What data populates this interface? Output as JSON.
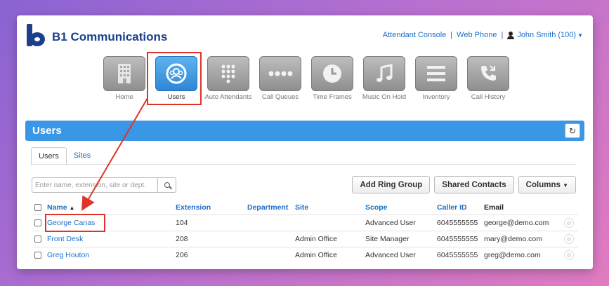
{
  "brand": {
    "name": "B1 Communications"
  },
  "topnav": {
    "attendant_console": "Attendant Console",
    "separator": "|",
    "web_phone": "Web Phone",
    "user": "John Smith (100)"
  },
  "apps": [
    {
      "label": "Home",
      "icon": "building-icon",
      "active": false
    },
    {
      "label": "Users",
      "icon": "users-icon",
      "active": true
    },
    {
      "label": "Auto Attendants",
      "icon": "keypad-icon",
      "active": false
    },
    {
      "label": "Call Queues",
      "icon": "dots-icon",
      "active": false
    },
    {
      "label": "Time Frames",
      "icon": "clock-icon",
      "active": false
    },
    {
      "label": "Music On Hold",
      "icon": "music-icon",
      "active": false
    },
    {
      "label": "Inventory",
      "icon": "list-icon",
      "active": false
    },
    {
      "label": "Call History",
      "icon": "phone-icon",
      "active": false
    }
  ],
  "banner": {
    "title": "Users"
  },
  "tabs": [
    {
      "label": "Users",
      "active": true
    },
    {
      "label": "Sites",
      "active": false
    }
  ],
  "search": {
    "placeholder": "Enter name, extension, site or dept."
  },
  "actions": {
    "add_ring_group": "Add Ring Group",
    "shared_contacts": "Shared Contacts",
    "columns": "Columns"
  },
  "table": {
    "headers": {
      "name": "Name",
      "extension": "Extension",
      "department": "Department",
      "site": "Site",
      "scope": "Scope",
      "caller_id": "Caller ID",
      "email": "Email"
    },
    "rows": [
      {
        "name": "George Canas",
        "extension": "104",
        "department": "",
        "site": "",
        "scope": "Advanced User",
        "caller_id": "6045555555",
        "email": "george@demo.com"
      },
      {
        "name": "Front Desk",
        "extension": "208",
        "department": "",
        "site": "Admin Office",
        "scope": "Site Manager",
        "caller_id": "6045555555",
        "email": "mary@demo.com"
      },
      {
        "name": "Greg Houton",
        "extension": "206",
        "department": "",
        "site": "Admin Office",
        "scope": "Advanced User",
        "caller_id": "6045555555",
        "email": "greg@demo.com"
      }
    ]
  },
  "colors": {
    "accent": "#3a97e6",
    "link": "#1a6fc9",
    "brand": "#1c3f8c",
    "annotation": "#e0342a"
  }
}
